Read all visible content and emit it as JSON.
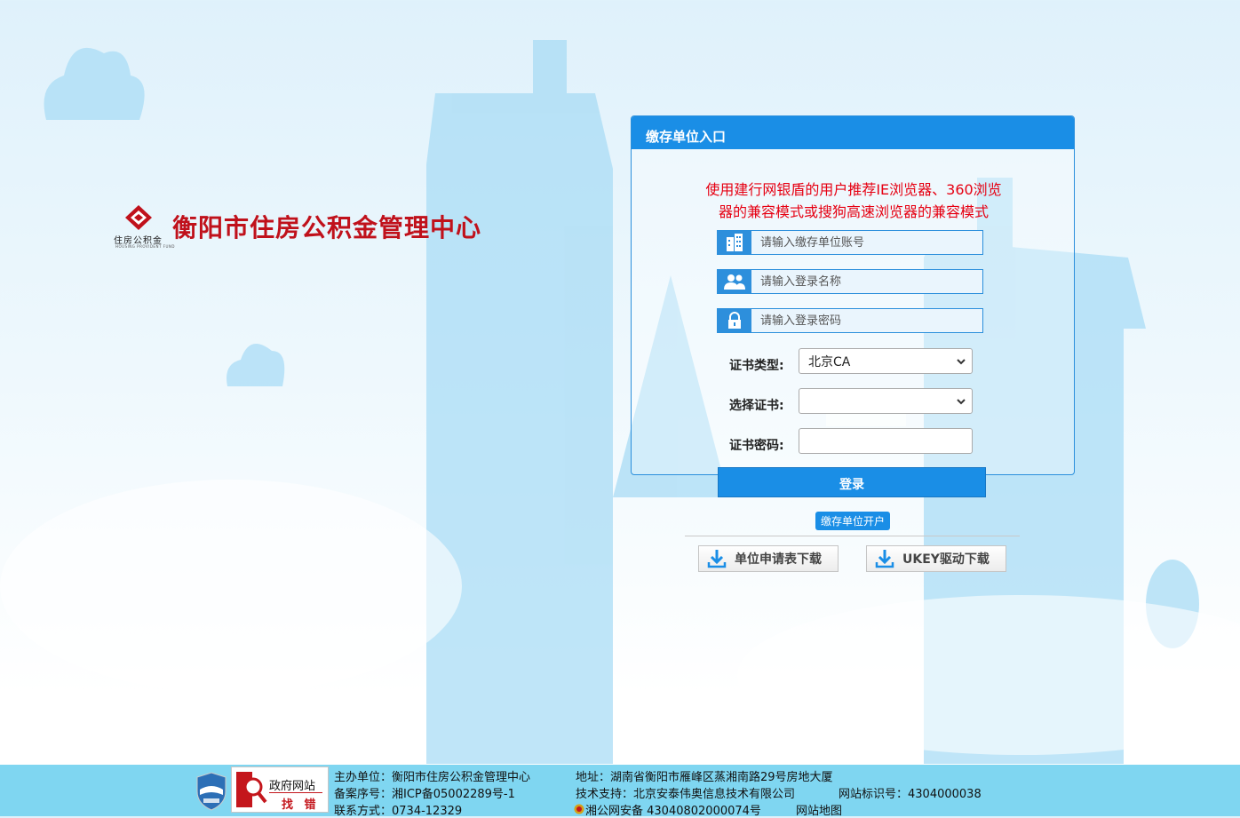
{
  "logo": {
    "title": "衡阳市住房公积金管理中心",
    "mark_text": "住房公积金",
    "mark_subtext": "HOUSING PROVIDENT FUND"
  },
  "panel": {
    "title": "缴存单位入口",
    "notice_line1": "使用建行网银盾的用户推荐IE浏览器、360浏览",
    "notice_line2": "器的兼容模式或搜狗高速浏览器的兼容模式",
    "account_placeholder": "请输入缴存单位账号",
    "username_placeholder": "请输入登录名称",
    "password_placeholder": "请输入登录密码",
    "cert_type_label": "证书类型:",
    "cert_type_value": "北京CA",
    "cert_select_label": "选择证书:",
    "cert_select_value": "",
    "cert_password_label": "证书密码:"
  },
  "actions": {
    "login_label": "登录",
    "open_account_label": "缴存单位开户",
    "download_form_label": "单位申请表下载",
    "download_ukey_label": "UKEY驱动下载"
  },
  "footer": {
    "gov_site_label": "政府网站",
    "find_error_label": "找 错",
    "sponsor": "主办单位：衡阳市住房公积金管理中心",
    "icp": "备案序号：湘ICP备05002289号-1",
    "contact": "联系方式：0734-12329",
    "address": "地址：湖南省衡阳市雁峰区蒸湘南路29号房地大厦",
    "tech_support": "技术支持：北京安泰伟奥信息技术有限公司",
    "site_id": "网站标识号：4304000038",
    "police_record": "湘公网安备 43040802000074号",
    "sitemap": "网站地图"
  },
  "colors": {
    "accent": "#1a8ee6",
    "brand_red": "#c0111b",
    "notice_red": "#e60012",
    "footer_bg": "#7fd6f1"
  }
}
